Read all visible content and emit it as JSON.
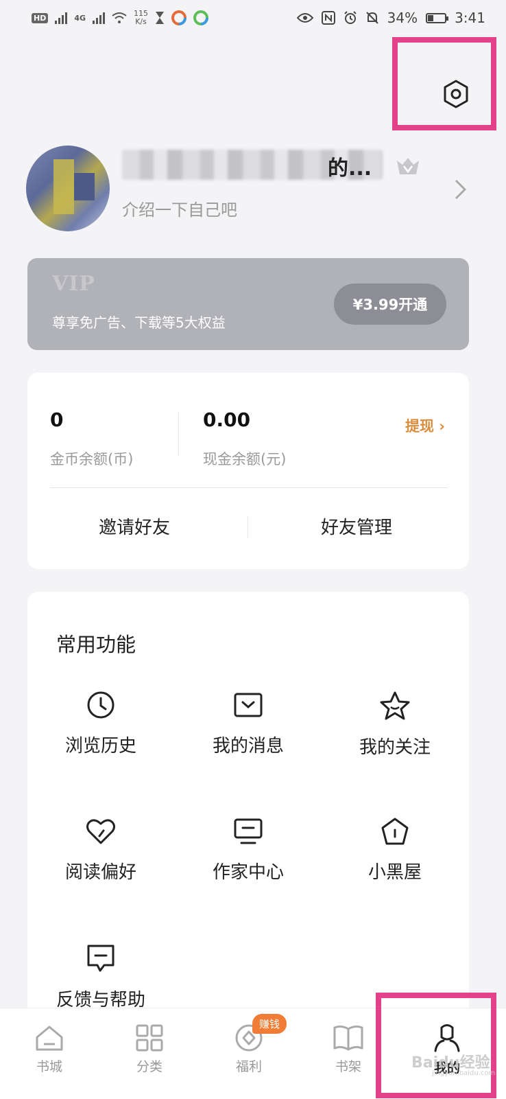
{
  "status_bar": {
    "hd_label": "HD",
    "network": "4G",
    "speed_value": "115",
    "speed_unit": "K/s",
    "battery": "34%",
    "battery_level": 0.34,
    "time": "3:41"
  },
  "header": {
    "settings_icon": "gear-hexagon-icon"
  },
  "profile": {
    "name_visible": "的...",
    "bio": "介绍一下自己吧"
  },
  "vip": {
    "logo": "VIP",
    "description": "尊享免广告、下载等5大权益",
    "button": "¥3.99开通"
  },
  "wallet": {
    "coins_value": "0",
    "coins_label": "金币余额(币)",
    "cash_value": "0.00",
    "cash_label": "现金余额(元)",
    "withdraw": "提现 ›",
    "invite": "邀请好友",
    "manage_friends": "好友管理",
    "accent_color": "#d98e3f"
  },
  "functions": {
    "title": "常用功能",
    "items": [
      {
        "label": "浏览历史",
        "icon": "clock-icon"
      },
      {
        "label": "我的消息",
        "icon": "message-icon"
      },
      {
        "label": "我的关注",
        "icon": "star-icon"
      },
      {
        "label": "阅读偏好",
        "icon": "heart-icon"
      },
      {
        "label": "作家中心",
        "icon": "monitor-icon"
      },
      {
        "label": "小黑屋",
        "icon": "house-icon"
      },
      {
        "label": "反馈与帮助",
        "icon": "feedback-icon"
      }
    ]
  },
  "bottom_nav": {
    "items": [
      {
        "label": "书城",
        "icon": "home-icon"
      },
      {
        "label": "分类",
        "icon": "grid-icon"
      },
      {
        "label": "福利",
        "icon": "coin-icon",
        "badge": "赚钱"
      },
      {
        "label": "书架",
        "icon": "book-icon"
      },
      {
        "label": "我的",
        "icon": "person-icon",
        "active": true
      }
    ]
  },
  "watermark": {
    "text": "Baidu经验",
    "sub": "jingyan.baidu.com"
  },
  "colors": {
    "highlight": "#e4418b",
    "badge": "#f07c35",
    "vip_card": "#b1b1b8"
  }
}
